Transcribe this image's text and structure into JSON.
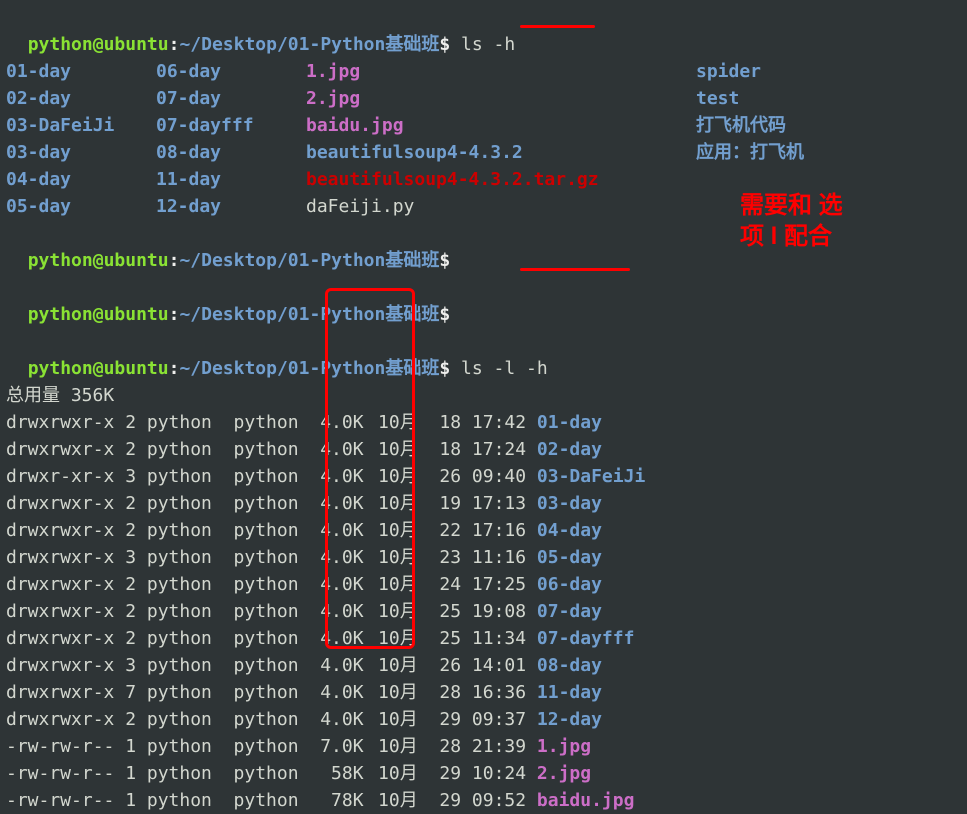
{
  "prompt": {
    "user": "python",
    "at": "@",
    "host": "ubuntu",
    "colon": ":",
    "path": "~/Desktop/01-Python基础班",
    "dollar": "$ "
  },
  "cmd1": "ls -h",
  "ls_cols": [
    [
      {
        "text": "01-day",
        "cls": "dir"
      },
      {
        "text": "06-day",
        "cls": "dir"
      },
      {
        "text": "1.jpg",
        "cls": "jpg"
      },
      {
        "text": "spider",
        "cls": "dir"
      }
    ],
    [
      {
        "text": "02-day",
        "cls": "dir"
      },
      {
        "text": "07-day",
        "cls": "dir"
      },
      {
        "text": "2.jpg",
        "cls": "jpg"
      },
      {
        "text": "test",
        "cls": "dir"
      }
    ],
    [
      {
        "text": "03-DaFeiJi",
        "cls": "dir"
      },
      {
        "text": "07-dayfff",
        "cls": "dir"
      },
      {
        "text": "baidu.jpg",
        "cls": "jpg"
      },
      {
        "text": "打飞机代码",
        "cls": "dir"
      }
    ],
    [
      {
        "text": "03-day",
        "cls": "dir"
      },
      {
        "text": "08-day",
        "cls": "dir"
      },
      {
        "text": "beautifulsoup4-4.3.2",
        "cls": "dir"
      },
      {
        "text": "应用：打飞机",
        "cls": "dir"
      }
    ],
    [
      {
        "text": "04-day",
        "cls": "dir"
      },
      {
        "text": "11-day",
        "cls": "dir"
      },
      {
        "text": "beautifulsoup4-4.3.2.tar.gz",
        "cls": "tar"
      },
      {
        "text": "",
        "cls": "plain"
      }
    ],
    [
      {
        "text": "05-day",
        "cls": "dir"
      },
      {
        "text": "12-day",
        "cls": "dir"
      },
      {
        "text": "daFeiji.py",
        "cls": "plain"
      },
      {
        "text": "",
        "cls": "plain"
      }
    ]
  ],
  "empty_cmd": "",
  "cmd2": "ls -l -h",
  "total_label": "总用量 356K",
  "ll_rows": [
    {
      "perm": "drwxrwxr-x",
      "links": "2",
      "owner": "python",
      "group": "python",
      "size": "4.0K",
      "month": "10月",
      "day": "18",
      "time": "17:42",
      "name": "01-day",
      "cls": "dir"
    },
    {
      "perm": "drwxrwxr-x",
      "links": "2",
      "owner": "python",
      "group": "python",
      "size": "4.0K",
      "month": "10月",
      "day": "18",
      "time": "17:24",
      "name": "02-day",
      "cls": "dir"
    },
    {
      "perm": "drwxr-xr-x",
      "links": "3",
      "owner": "python",
      "group": "python",
      "size": "4.0K",
      "month": "10月",
      "day": "26",
      "time": "09:40",
      "name": "03-DaFeiJi",
      "cls": "dir"
    },
    {
      "perm": "drwxrwxr-x",
      "links": "2",
      "owner": "python",
      "group": "python",
      "size": "4.0K",
      "month": "10月",
      "day": "19",
      "time": "17:13",
      "name": "03-day",
      "cls": "dir"
    },
    {
      "perm": "drwxrwxr-x",
      "links": "2",
      "owner": "python",
      "group": "python",
      "size": "4.0K",
      "month": "10月",
      "day": "22",
      "time": "17:16",
      "name": "04-day",
      "cls": "dir"
    },
    {
      "perm": "drwxrwxr-x",
      "links": "3",
      "owner": "python",
      "group": "python",
      "size": "4.0K",
      "month": "10月",
      "day": "23",
      "time": "11:16",
      "name": "05-day",
      "cls": "dir"
    },
    {
      "perm": "drwxrwxr-x",
      "links": "2",
      "owner": "python",
      "group": "python",
      "size": "4.0K",
      "month": "10月",
      "day": "24",
      "time": "17:25",
      "name": "06-day",
      "cls": "dir"
    },
    {
      "perm": "drwxrwxr-x",
      "links": "2",
      "owner": "python",
      "group": "python",
      "size": "4.0K",
      "month": "10月",
      "day": "25",
      "time": "19:08",
      "name": "07-day",
      "cls": "dir"
    },
    {
      "perm": "drwxrwxr-x",
      "links": "2",
      "owner": "python",
      "group": "python",
      "size": "4.0K",
      "month": "10月",
      "day": "25",
      "time": "11:34",
      "name": "07-dayfff",
      "cls": "dir"
    },
    {
      "perm": "drwxrwxr-x",
      "links": "3",
      "owner": "python",
      "group": "python",
      "size": "4.0K",
      "month": "10月",
      "day": "26",
      "time": "14:01",
      "name": "08-day",
      "cls": "dir"
    },
    {
      "perm": "drwxrwxr-x",
      "links": "7",
      "owner": "python",
      "group": "python",
      "size": "4.0K",
      "month": "10月",
      "day": "28",
      "time": "16:36",
      "name": "11-day",
      "cls": "dir"
    },
    {
      "perm": "drwxrwxr-x",
      "links": "2",
      "owner": "python",
      "group": "python",
      "size": "4.0K",
      "month": "10月",
      "day": "29",
      "time": "09:37",
      "name": "12-day",
      "cls": "dir"
    },
    {
      "perm": "-rw-rw-r--",
      "links": "1",
      "owner": "python",
      "group": "python",
      "size": "7.0K",
      "month": "10月",
      "day": "28",
      "time": "21:39",
      "name": "1.jpg",
      "cls": "jpg"
    },
    {
      "perm": "-rw-rw-r--",
      "links": "1",
      "owner": "python",
      "group": "python",
      "size": "58K",
      "month": "10月",
      "day": "29",
      "time": "10:24",
      "name": "2.jpg",
      "cls": "jpg"
    },
    {
      "perm": "-rw-rw-r--",
      "links": "1",
      "owner": "python",
      "group": "python",
      "size": "78K",
      "month": "10月",
      "day": "29",
      "time": "09:52",
      "name": "baidu.jpg",
      "cls": "jpg"
    }
  ],
  "annotation": {
    "line1": "需要和 选",
    "line2": "项 l 配合"
  }
}
